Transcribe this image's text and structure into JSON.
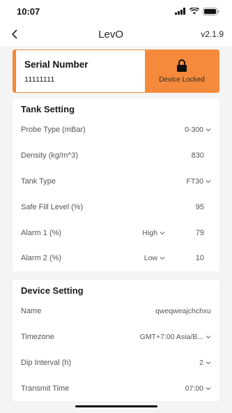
{
  "status": {
    "time": "10:07"
  },
  "nav": {
    "title": "LevO",
    "version": "v2.1.9"
  },
  "serial": {
    "title": "Serial Number",
    "value": "11111111",
    "lock_label": "Device Locked"
  },
  "tank": {
    "title": "Tank Setting",
    "rows": [
      {
        "label": "Probe Type (mBar)",
        "value": "0-300"
      },
      {
        "label": "Density (kg/m^3)",
        "value": "830"
      },
      {
        "label": "Tank Type",
        "value": "FT30"
      },
      {
        "label": "Safe Fill Level (%)",
        "value": "95"
      },
      {
        "label": "Alarm 1 (%)",
        "level": "High",
        "value": "79"
      },
      {
        "label": "Alarm 2 (%)",
        "level": "Low",
        "value": "10"
      }
    ]
  },
  "device": {
    "title": "Device Setting",
    "rows": [
      {
        "label": "Name",
        "value": "qweqweajchchxu"
      },
      {
        "label": "Timezone",
        "value": "GMT+7:00 Asia/B..."
      },
      {
        "label": "Dip Interval (h)",
        "value": "2"
      },
      {
        "label": "Transmit Time",
        "value": "07:00"
      }
    ]
  },
  "icons": {
    "back": "chevron-left-icon",
    "lock": "lock-icon",
    "dropdown": "chevron-down-icon"
  },
  "colors": {
    "accent": "#f58a3c"
  }
}
